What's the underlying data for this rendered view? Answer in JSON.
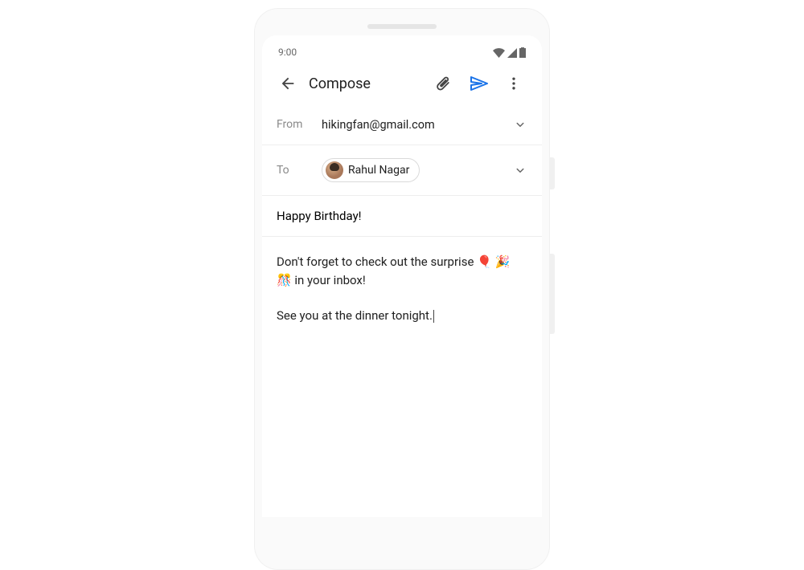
{
  "status": {
    "time": "9:00"
  },
  "appbar": {
    "title": "Compose"
  },
  "from": {
    "label": "From",
    "value": "hikingfan@gmail.com"
  },
  "to": {
    "label": "To",
    "chip_name": "Rahul Nagar"
  },
  "subject": "Happy Birthday!",
  "body": {
    "line1_pre": "Don't forget to check out the surprise",
    "emojis": " 🎈 🎉 🎊 ",
    "line1_post": "in your inbox!",
    "line2": "See you at the dinner tonight."
  }
}
